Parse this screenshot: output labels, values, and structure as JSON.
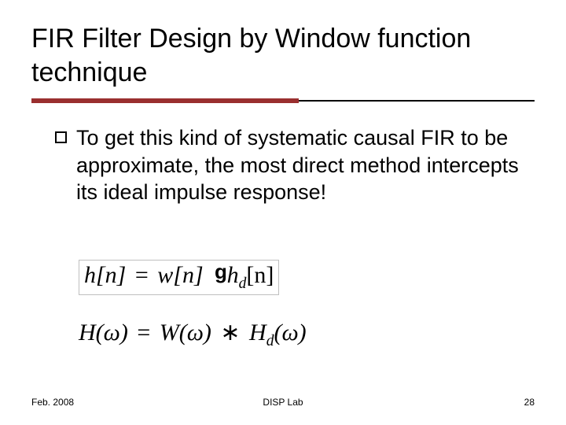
{
  "title": "FIR Filter Design by Window function technique",
  "bullet": "To get this kind of systematic causal FIR to be approximate, the most direct method intercepts its ideal impulse response!",
  "equation1_html": "h[n] = w[n] h_d[n]",
  "equation1": {
    "lhs": "h[n]",
    "eq": "=",
    "rhs1": "w[n]",
    "dot": "g",
    "rhs2_base": "h",
    "rhs2_sub": "d",
    "rhs2_arg": "[n]"
  },
  "equation2_html": "H(ω) = W(ω) * H_d(ω)",
  "equation2": {
    "lhs": "H(ω)",
    "eq": "=",
    "rhs1": "W(ω)",
    "conv": "∗",
    "rhs2_base": "H",
    "rhs2_sub": "d",
    "rhs2_arg": "(ω)"
  },
  "footer": {
    "left": "Feb. 2008",
    "center": "DISP Lab",
    "right": "28"
  }
}
